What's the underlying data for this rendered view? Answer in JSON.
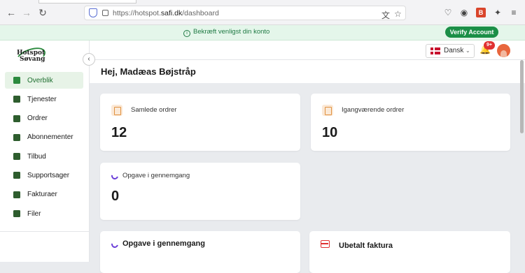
{
  "browser": {
    "url_prefix": "https://hotspot.",
    "url_domain": "safi.dk",
    "url_suffix": "/dashboard",
    "icons": [
      "back-icon",
      "forward-icon",
      "reload-icon",
      "shield-icon",
      "lock-icon",
      "translate-icon",
      "bookmark-star-icon",
      "pocket-icon",
      "account-icon",
      "extension-icon",
      "puzzle-icon",
      "menu-icon"
    ]
  },
  "banner": {
    "message": "Bekræft venligst din konto",
    "button": "Verify Account"
  },
  "sidebar": {
    "logo_line1": "Hotspot",
    "logo_line2": "Søvang",
    "items": [
      {
        "label": "Overblik",
        "active": true
      },
      {
        "label": "Tjenester",
        "active": false
      },
      {
        "label": "Ordrer",
        "active": false
      },
      {
        "label": "Abonnementer",
        "active": false
      },
      {
        "label": "Tilbud",
        "active": false
      },
      {
        "label": "Supportsager",
        "active": false
      },
      {
        "label": "Fakturaer",
        "active": false
      },
      {
        "label": "Filer",
        "active": false
      }
    ]
  },
  "topbar": {
    "language": "Dansk",
    "notification_count": "9+"
  },
  "greeting": "Hej, Madæas Bøjstråp",
  "cards": {
    "total_orders": {
      "label": "Samlede ordrer",
      "value": "12"
    },
    "active_orders": {
      "label": "Igangværende ordrer",
      "value": "10"
    },
    "in_review": {
      "label": "Opgave i gennemgang",
      "value": "0"
    }
  },
  "panels": {
    "review": "Opgave i gennemgang",
    "unpaid": "Ubetalt faktura"
  },
  "colors": {
    "accent": "#2b8a3e",
    "banner_bg": "#e4f6ea",
    "badge": "#e03131",
    "review_icon": "#6b3fd8"
  }
}
